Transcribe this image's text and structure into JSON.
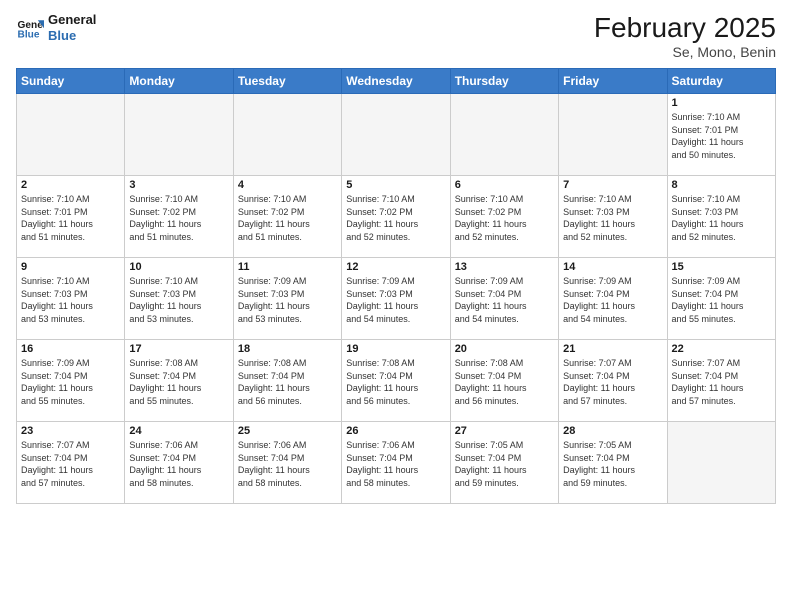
{
  "logo": {
    "line1": "General",
    "line2": "Blue"
  },
  "title": "February 2025",
  "subtitle": "Se, Mono, Benin",
  "weekdays": [
    "Sunday",
    "Monday",
    "Tuesday",
    "Wednesday",
    "Thursday",
    "Friday",
    "Saturday"
  ],
  "weeks": [
    [
      {
        "day": "",
        "info": ""
      },
      {
        "day": "",
        "info": ""
      },
      {
        "day": "",
        "info": ""
      },
      {
        "day": "",
        "info": ""
      },
      {
        "day": "",
        "info": ""
      },
      {
        "day": "",
        "info": ""
      },
      {
        "day": "1",
        "info": "Sunrise: 7:10 AM\nSunset: 7:01 PM\nDaylight: 11 hours\nand 50 minutes."
      }
    ],
    [
      {
        "day": "2",
        "info": "Sunrise: 7:10 AM\nSunset: 7:01 PM\nDaylight: 11 hours\nand 51 minutes."
      },
      {
        "day": "3",
        "info": "Sunrise: 7:10 AM\nSunset: 7:02 PM\nDaylight: 11 hours\nand 51 minutes."
      },
      {
        "day": "4",
        "info": "Sunrise: 7:10 AM\nSunset: 7:02 PM\nDaylight: 11 hours\nand 51 minutes."
      },
      {
        "day": "5",
        "info": "Sunrise: 7:10 AM\nSunset: 7:02 PM\nDaylight: 11 hours\nand 52 minutes."
      },
      {
        "day": "6",
        "info": "Sunrise: 7:10 AM\nSunset: 7:02 PM\nDaylight: 11 hours\nand 52 minutes."
      },
      {
        "day": "7",
        "info": "Sunrise: 7:10 AM\nSunset: 7:03 PM\nDaylight: 11 hours\nand 52 minutes."
      },
      {
        "day": "8",
        "info": "Sunrise: 7:10 AM\nSunset: 7:03 PM\nDaylight: 11 hours\nand 52 minutes."
      }
    ],
    [
      {
        "day": "9",
        "info": "Sunrise: 7:10 AM\nSunset: 7:03 PM\nDaylight: 11 hours\nand 53 minutes."
      },
      {
        "day": "10",
        "info": "Sunrise: 7:10 AM\nSunset: 7:03 PM\nDaylight: 11 hours\nand 53 minutes."
      },
      {
        "day": "11",
        "info": "Sunrise: 7:09 AM\nSunset: 7:03 PM\nDaylight: 11 hours\nand 53 minutes."
      },
      {
        "day": "12",
        "info": "Sunrise: 7:09 AM\nSunset: 7:03 PM\nDaylight: 11 hours\nand 54 minutes."
      },
      {
        "day": "13",
        "info": "Sunrise: 7:09 AM\nSunset: 7:04 PM\nDaylight: 11 hours\nand 54 minutes."
      },
      {
        "day": "14",
        "info": "Sunrise: 7:09 AM\nSunset: 7:04 PM\nDaylight: 11 hours\nand 54 minutes."
      },
      {
        "day": "15",
        "info": "Sunrise: 7:09 AM\nSunset: 7:04 PM\nDaylight: 11 hours\nand 55 minutes."
      }
    ],
    [
      {
        "day": "16",
        "info": "Sunrise: 7:09 AM\nSunset: 7:04 PM\nDaylight: 11 hours\nand 55 minutes."
      },
      {
        "day": "17",
        "info": "Sunrise: 7:08 AM\nSunset: 7:04 PM\nDaylight: 11 hours\nand 55 minutes."
      },
      {
        "day": "18",
        "info": "Sunrise: 7:08 AM\nSunset: 7:04 PM\nDaylight: 11 hours\nand 56 minutes."
      },
      {
        "day": "19",
        "info": "Sunrise: 7:08 AM\nSunset: 7:04 PM\nDaylight: 11 hours\nand 56 minutes."
      },
      {
        "day": "20",
        "info": "Sunrise: 7:08 AM\nSunset: 7:04 PM\nDaylight: 11 hours\nand 56 minutes."
      },
      {
        "day": "21",
        "info": "Sunrise: 7:07 AM\nSunset: 7:04 PM\nDaylight: 11 hours\nand 57 minutes."
      },
      {
        "day": "22",
        "info": "Sunrise: 7:07 AM\nSunset: 7:04 PM\nDaylight: 11 hours\nand 57 minutes."
      }
    ],
    [
      {
        "day": "23",
        "info": "Sunrise: 7:07 AM\nSunset: 7:04 PM\nDaylight: 11 hours\nand 57 minutes."
      },
      {
        "day": "24",
        "info": "Sunrise: 7:06 AM\nSunset: 7:04 PM\nDaylight: 11 hours\nand 58 minutes."
      },
      {
        "day": "25",
        "info": "Sunrise: 7:06 AM\nSunset: 7:04 PM\nDaylight: 11 hours\nand 58 minutes."
      },
      {
        "day": "26",
        "info": "Sunrise: 7:06 AM\nSunset: 7:04 PM\nDaylight: 11 hours\nand 58 minutes."
      },
      {
        "day": "27",
        "info": "Sunrise: 7:05 AM\nSunset: 7:04 PM\nDaylight: 11 hours\nand 59 minutes."
      },
      {
        "day": "28",
        "info": "Sunrise: 7:05 AM\nSunset: 7:04 PM\nDaylight: 11 hours\nand 59 minutes."
      },
      {
        "day": "",
        "info": ""
      }
    ]
  ]
}
